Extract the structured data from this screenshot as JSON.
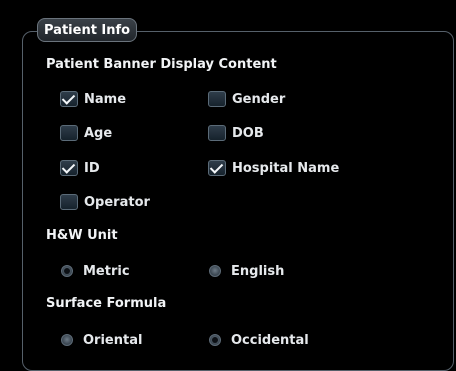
{
  "group": {
    "title": "Patient Info"
  },
  "banner": {
    "label": "Patient Banner Display Content",
    "options": {
      "name": {
        "label": "Name",
        "checked": true
      },
      "gender": {
        "label": "Gender",
        "checked": false
      },
      "age": {
        "label": "Age",
        "checked": false
      },
      "dob": {
        "label": "DOB",
        "checked": false
      },
      "id": {
        "label": "ID",
        "checked": true
      },
      "hospital_name": {
        "label": "Hospital Name",
        "checked": true
      },
      "operator": {
        "label": "Operator",
        "checked": false
      }
    }
  },
  "hw_unit": {
    "label": "H&W Unit",
    "selected": "Metric",
    "options": {
      "metric": {
        "label": "Metric"
      },
      "english": {
        "label": "English"
      }
    }
  },
  "surface_formula": {
    "label": "Surface Formula",
    "selected": "Occidental",
    "options": {
      "oriental": {
        "label": "Oriental"
      },
      "occidental": {
        "label": "Occidental"
      }
    }
  }
}
